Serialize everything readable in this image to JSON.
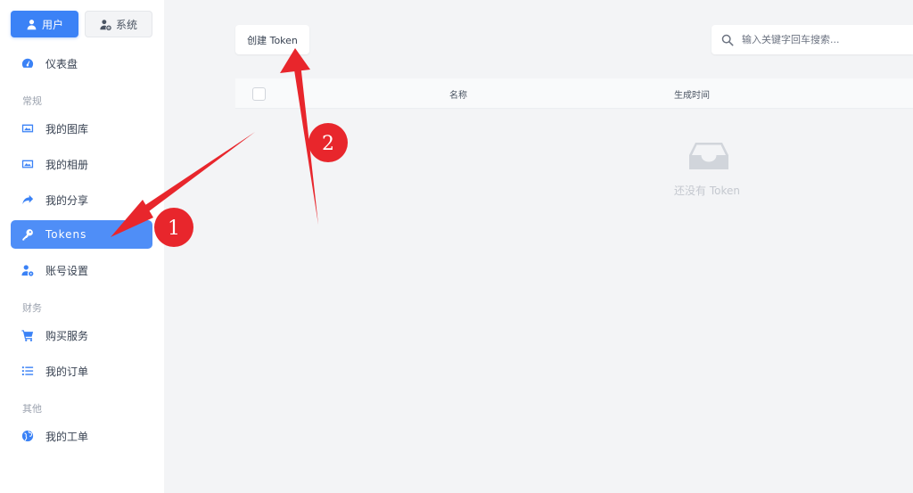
{
  "sidebar": {
    "role_switch": [
      {
        "label": "用户",
        "icon": "user-icon",
        "active": true
      },
      {
        "label": "系统",
        "icon": "user-cog-icon",
        "active": false
      }
    ],
    "dashboard": {
      "label": "仪表盘",
      "icon": "dashboard-icon"
    },
    "sections": {
      "general": "常规",
      "finance": "财务",
      "other": "其他"
    },
    "items": [
      {
        "label": "我的图库",
        "icon": "image-icon"
      },
      {
        "label": "我的相册",
        "icon": "album-icon"
      },
      {
        "label": "我的分享",
        "icon": "share-icon"
      },
      {
        "label": "Tokens",
        "icon": "key-icon",
        "active": true
      },
      {
        "label": "账号设置",
        "icon": "user-settings-icon"
      },
      {
        "label": "购买服务",
        "icon": "cart-icon"
      },
      {
        "label": "我的订单",
        "icon": "list-icon"
      },
      {
        "label": "我的工单",
        "icon": "globe-icon"
      }
    ]
  },
  "main": {
    "create_button": "创建 Token",
    "search": {
      "placeholder": "输入关键字回车搜索...",
      "value": ""
    },
    "table": {
      "columns": [
        "名称",
        "生成时间"
      ]
    },
    "empty_text": "还没有 Token"
  },
  "annotations": [
    {
      "number": "1",
      "target": "Tokens"
    },
    {
      "number": "2",
      "target": "创建 Token"
    }
  ],
  "colors": {
    "accent": "#3b82f6",
    "active_item": "#4f8ef7",
    "annotation": "#e8262c"
  }
}
